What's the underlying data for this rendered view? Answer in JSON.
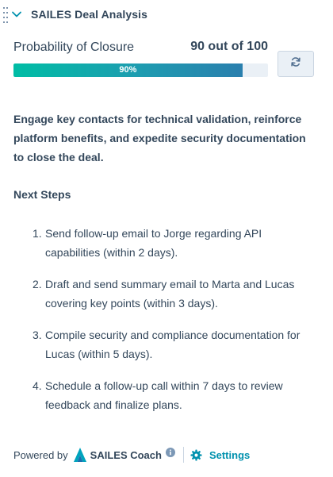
{
  "header": {
    "title": "SAILES Deal Analysis",
    "collapse_icon": "chevron-down-icon",
    "drag_icon": "drag-handle-icon"
  },
  "probability": {
    "label": "Probability of Closure",
    "score_text": "90 out of 100",
    "percent": 90,
    "bar_label": "90%",
    "refresh_icon": "refresh-icon"
  },
  "summary": "Engage key contacts for technical validation, reinforce platform benefits, and expedite security documentation to close the deal.",
  "next_steps": {
    "title": "Next Steps",
    "items": [
      {
        "num": "1.",
        "text": "Send follow-up email to Jorge regarding API capabilities (within 2 days)."
      },
      {
        "num": "2.",
        "text": "Draft and send summary email to Marta and Lucas covering key points (within 3 days)."
      },
      {
        "num": "3.",
        "text": "Compile security and compliance documentation for Lucas (within 5 days)."
      },
      {
        "num": "4.",
        "text": "Schedule a follow-up call within 7 days to review feedback and finalize plans."
      }
    ]
  },
  "footer": {
    "powered_by": "Powered by",
    "brand": "SAILES Coach",
    "settings_label": "Settings",
    "info_icon": "info-icon",
    "settings_icon": "gear-icon"
  },
  "colors": {
    "bar_start": "#00bda5",
    "bar_end": "#2a7fae",
    "link": "#0091ae",
    "text": "#33475b"
  }
}
